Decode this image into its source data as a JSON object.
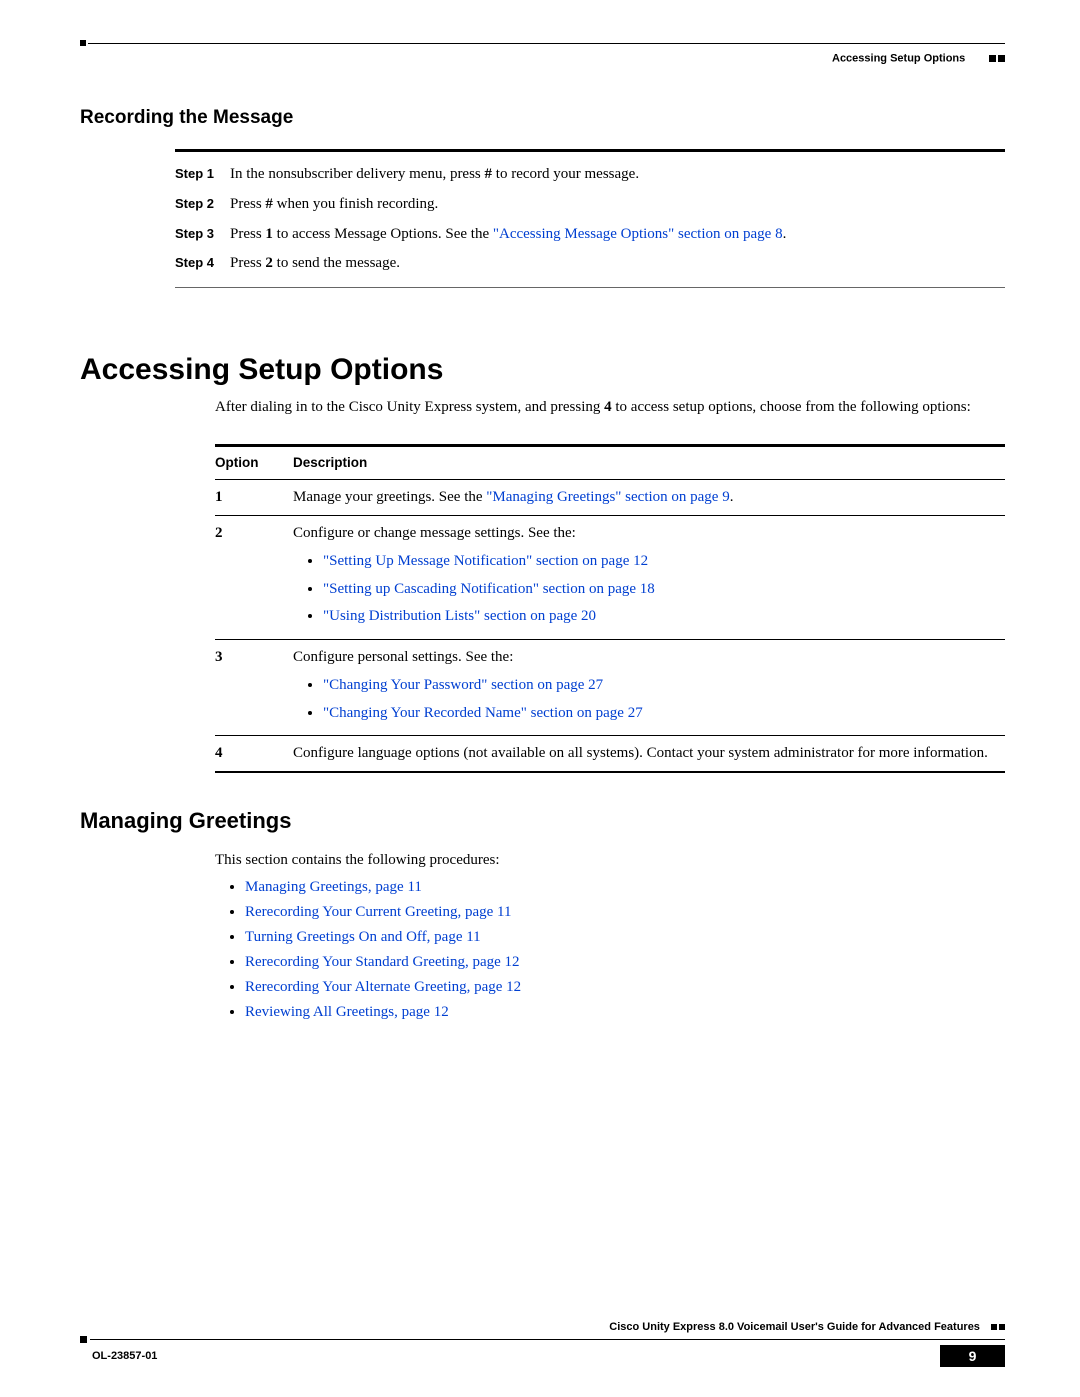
{
  "header": {
    "chapter_label": "Accessing Setup Options"
  },
  "sec_recording": {
    "heading": "Recording the Message",
    "steps": [
      {
        "label": "Step 1",
        "pre": "In the nonsubscriber delivery menu, press ",
        "key": "#",
        "post": " to record your message."
      },
      {
        "label": "Step 2",
        "pre": "Press ",
        "key": "#",
        "post": " when you finish recording."
      },
      {
        "label": "Step 3",
        "pre": "Press ",
        "key": "1",
        "post_a": " to access Message Options. See the ",
        "link": "\"Accessing Message Options\" section on page 8",
        "tail": "."
      },
      {
        "label": "Step 4",
        "pre": "Press ",
        "key": "2",
        "post": " to send the message."
      }
    ]
  },
  "sec_setup": {
    "heading": "Accessing Setup Options",
    "intro_a": "After dialing in to the Cisco Unity Express system, and pressing ",
    "intro_key": "4",
    "intro_b": " to access setup options, choose from the following options:",
    "table": {
      "head": {
        "c1": "Option",
        "c2": "Description"
      },
      "rows": [
        {
          "opt": "1",
          "lead": "Manage your greetings. See the ",
          "link": "\"Managing Greetings\" section on page 9",
          "tail": "."
        },
        {
          "opt": "2",
          "lead": "Configure or change message settings. See the:",
          "bullets": [
            "\"Setting Up Message Notification\" section on page 12",
            "\"Setting up Cascading Notification\" section on page 18",
            "\"Using Distribution Lists\" section on page 20"
          ]
        },
        {
          "opt": "3",
          "lead": "Configure personal settings. See the:",
          "bullets": [
            "\"Changing Your Password\" section on page 27",
            "\"Changing Your Recorded Name\" section on page 27"
          ]
        },
        {
          "opt": "4",
          "lead": "Configure language options (not available on all systems). Contact your system administrator for more information."
        }
      ]
    }
  },
  "sec_greetings": {
    "heading": "Managing Greetings",
    "lead": "This section contains the following procedures:",
    "items": [
      "Managing Greetings, page 11",
      "Rerecording Your Current Greeting, page 11",
      "Turning Greetings On and Off, page 11",
      "Rerecording Your Standard Greeting, page 12",
      "Rerecording Your Alternate Greeting, page 12",
      "Reviewing All Greetings, page 12"
    ]
  },
  "footer": {
    "guide_title": "Cisco Unity Express 8.0 Voicemail User's Guide for Advanced Features",
    "doc_number": "OL-23857-01",
    "page_number": "9"
  }
}
